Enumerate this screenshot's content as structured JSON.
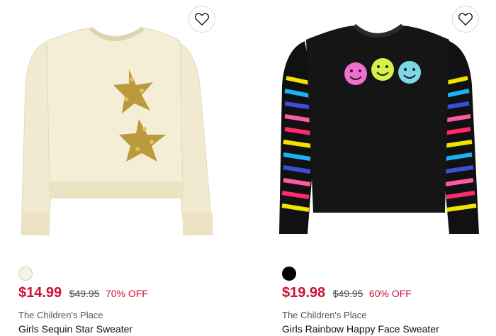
{
  "products": [
    {
      "image_alt": "cream sweater with gold sequin stars",
      "favorite_icon": "heart-outline-icon",
      "swatch_color": "#f7f2e3",
      "sale_price": "$14.99",
      "original_price": "$49.95",
      "discount": "70% OFF",
      "brand": "The Children's Place",
      "name": "Girls Sequin Star Sweater"
    },
    {
      "image_alt": "black sweater with happy faces and rainbow striped sleeves",
      "favorite_icon": "heart-outline-icon",
      "swatch_color": "#000000",
      "sale_price": "$19.98",
      "original_price": "$49.95",
      "discount": "60% OFF",
      "brand": "The Children's Place",
      "name": "Girls Rainbow Happy Face Sweater"
    }
  ],
  "colors": {
    "sale": "#cc0f35",
    "text": "#111111",
    "muted": "#555555"
  }
}
